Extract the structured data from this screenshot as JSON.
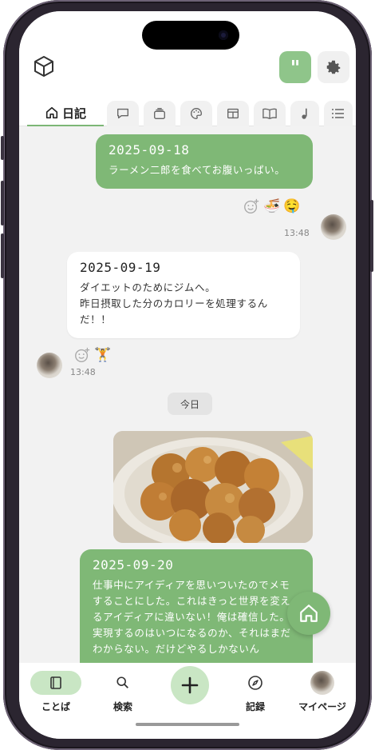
{
  "header": {
    "logo_icon": "cube-icon",
    "quote_label": "\"",
    "settings_icon": "gear-icon"
  },
  "tabs": [
    {
      "label": "日記",
      "icon": "home-icon",
      "active": true
    },
    {
      "label": "",
      "icon": "speech-bubble-icon"
    },
    {
      "label": "",
      "icon": "stack-icon"
    },
    {
      "label": "",
      "icon": "palette-icon"
    },
    {
      "label": "",
      "icon": "layout-icon"
    },
    {
      "label": "",
      "icon": "book-icon"
    },
    {
      "label": "",
      "icon": "music-note-icon"
    },
    {
      "label": "",
      "icon": "list-icon"
    }
  ],
  "messages": [
    {
      "date": "2025-09-18",
      "text": "ラーメン二郎を食べてお腹いっぱい。",
      "time": "13:48",
      "reactions": [
        "🍜",
        "🤤"
      ]
    },
    {
      "date": "2025-09-19",
      "text": "ダイエットのためにジムへ。\n昨日摂取した分のカロリーを処理するんだ！！",
      "time": "13:48",
      "reactions": [
        "🏋️"
      ]
    },
    {
      "date": "2025-09-20",
      "text": "仕事中にアイディアを思いついたのでメモすることにした。これはきっと世界を変えるアイディアに違いない！俺は確信した。\n実現するのはいつになるのか、それはまだわからない。だけどやるしかないん"
    }
  ],
  "today_label": "今日",
  "bottom_nav": [
    {
      "label": "ことば",
      "icon": "book-icon",
      "active": true
    },
    {
      "label": "検索",
      "icon": "search-icon"
    },
    {
      "label": "",
      "icon": "plus-icon"
    },
    {
      "label": "記録",
      "icon": "compass-icon"
    },
    {
      "label": "マイページ",
      "icon": "avatar"
    }
  ],
  "colors": {
    "accent": "#7fb876",
    "accent_light": "#c9e6c4",
    "background": "#f2f2f2"
  }
}
